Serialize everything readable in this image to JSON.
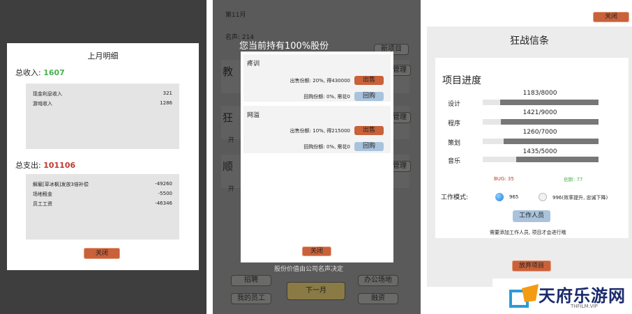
{
  "panel1": {
    "title": "上月明细",
    "income_label": "总收入:",
    "income_value": "1607",
    "income_rows": [
      {
        "label": "现金利息收入",
        "value": "321"
      },
      {
        "label": "游戏收入",
        "value": "1286"
      }
    ],
    "expense_label": "总支出:",
    "expense_value": "101106",
    "expense_rows": [
      {
        "label": "解雇[草冰枫]发放3倍补偿",
        "value": "-49260"
      },
      {
        "label": "场地租金",
        "value": "-5500"
      },
      {
        "label": "员工工资",
        "value": "-46346"
      }
    ],
    "close_label": "关闭"
  },
  "panel2": {
    "month": "第11月",
    "fame": "名声: 214",
    "headline": "您当前持有100%股份",
    "bg_project_btn": "新项目",
    "bg_manage_btn": "管理",
    "bg_row_chars": [
      "教",
      "狂",
      "顺"
    ],
    "bg_row_subs": [
      "开",
      "开"
    ],
    "items": [
      {
        "name": "疼训",
        "sell_text": "出售份额: 20%, 得430000",
        "sell_btn": "出售",
        "buy_text": "回购份额: 0%, 需花0",
        "buy_btn": "回购"
      },
      {
        "name": "网溢",
        "sell_text": "出售份额: 10%, 得215000",
        "sell_btn": "出售",
        "buy_text": "回购份额: 0%, 需花0",
        "buy_btn": "回购"
      }
    ],
    "close_label": "关闭",
    "footer_note": "股份价值由公司名声决定",
    "btn_recruit": "招聘",
    "btn_office": "办公场地",
    "btn_next": "下一月",
    "btn_staff": "我的员工",
    "btn_loan": "融资"
  },
  "panel3": {
    "close_label": "关闭",
    "title": "狂战信条",
    "progress_title": "项目进度",
    "progress": [
      {
        "label": "设计",
        "value": "1183/8000",
        "ratio": 0.148
      },
      {
        "label": "程序",
        "value": "1421/9000",
        "ratio": 0.158
      },
      {
        "label": "策划",
        "value": "1260/7000",
        "ratio": 0.18
      },
      {
        "label": "音乐",
        "value": "1435/5000",
        "ratio": 0.287
      }
    ],
    "bug_label": "BUG: 35",
    "innovation_label": "创新: 77",
    "mode_label": "工作模式:",
    "mode_options": [
      "965",
      "996(效率提升, 忠诚下降)"
    ],
    "staff_btn": "工作人员",
    "notice": "需要添加工作人员, 项目才会进行哦",
    "abandon_btn": "放弃项目"
  },
  "watermark": {
    "text": "天府乐游网",
    "sub": "THFILM.VIP"
  },
  "colors": {
    "green": "#4caf50",
    "red": "#c0392b",
    "orange": "#c9613a",
    "blue": "#a9c3dc"
  }
}
